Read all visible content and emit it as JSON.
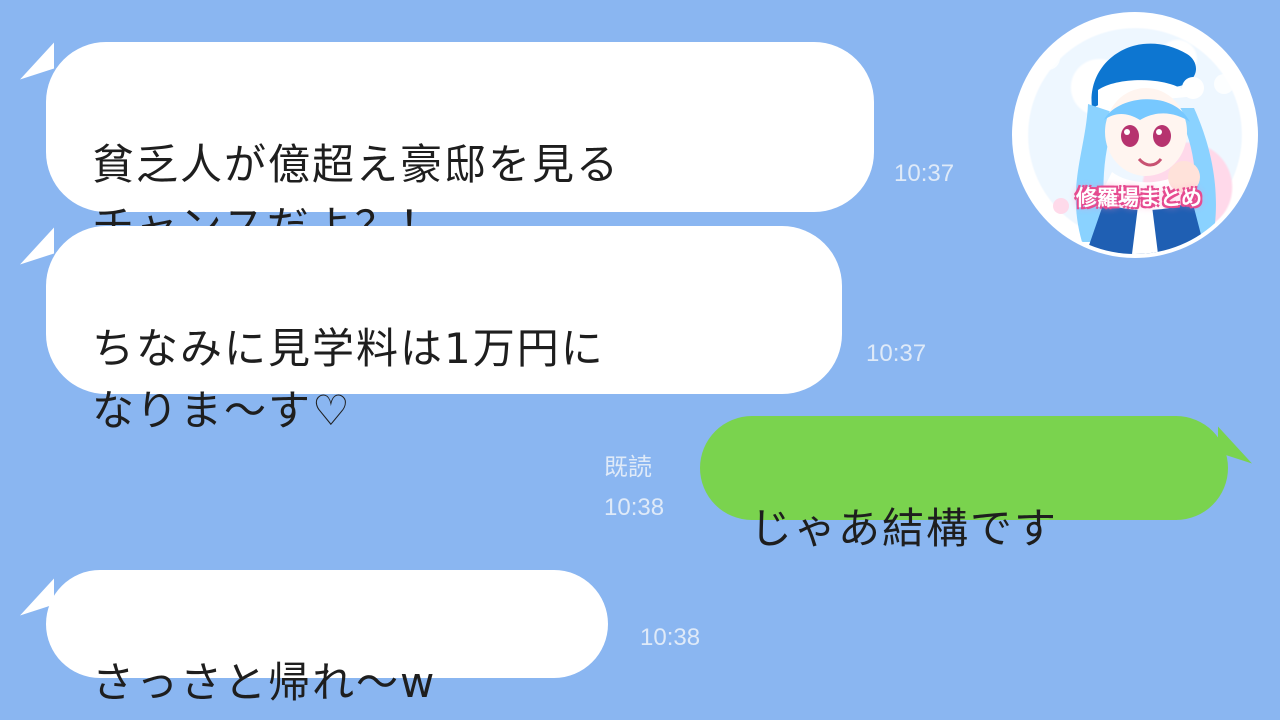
{
  "messages": [
    {
      "text": "貧乏人が億超え豪邸を見る\nチャンスだよ？！",
      "time": "10:37"
    },
    {
      "text": "ちなみに見学料は1万円に\nなりま〜す♡",
      "time": "10:37"
    },
    {
      "text": "じゃあ結構です",
      "read": "既読",
      "time": "10:38"
    },
    {
      "text": "さっさと帰れ〜w",
      "time": "10:38"
    }
  ],
  "avatar": {
    "label": "修羅場まとめ",
    "icon": "anime-girl-icon"
  },
  "colors": {
    "background": "#8ab6f1",
    "incoming_bubble": "#ffffff",
    "outgoing_bubble": "#7ad34e",
    "text": "#1e1e1e",
    "meta": "#dfeaf8"
  }
}
